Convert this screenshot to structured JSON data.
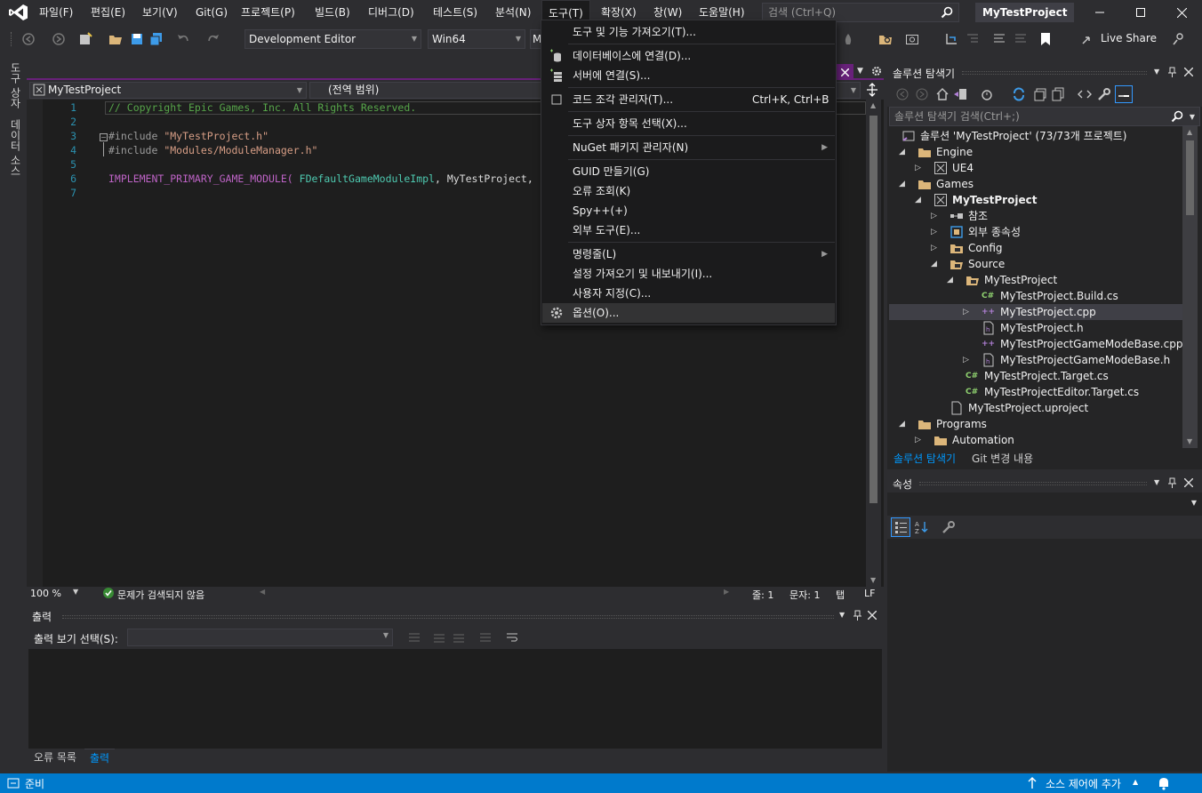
{
  "menu": {
    "file": "파일(F)",
    "edit": "편집(E)",
    "view": "보기(V)",
    "git": "Git(G)",
    "project": "프로젝트(P)",
    "build": "빌드(B)",
    "debug": "디버그(D)",
    "test": "테스트(S)",
    "analyze": "분석(N)",
    "tools": "도구(T)",
    "extensions": "확장(X)",
    "window": "창(W)",
    "help": "도움말(H)"
  },
  "search": {
    "placeholder": "검색 (Ctrl+Q)"
  },
  "window_title": "MyTestProject",
  "toolbar": {
    "config": "Development Editor",
    "platform": "Win64",
    "startup_partial": "M",
    "live_share": "Live Share"
  },
  "left_tabs": {
    "toolbox": "도구 상자",
    "data_sources": "데이터 소스"
  },
  "editor": {
    "project_combo": "MyTestProject",
    "scope_combo": "(전역 범위)",
    "lines": [
      {
        "num": "1",
        "comment": "// Copyright Epic Games, Inc. All Rights Reserved."
      },
      {
        "num": "2"
      },
      {
        "num": "3",
        "directive": "#include",
        "string": "\"MyTestProject.h\""
      },
      {
        "num": "4",
        "directive": "#include",
        "string": "\"Modules/ModuleManager.h\""
      },
      {
        "num": "5"
      },
      {
        "num": "6",
        "macro": "IMPLEMENT_PRIMARY_GAME_MODULE(",
        "type": "FDefaultGameModuleImpl",
        "rest": ", MyTestProject,"
      },
      {
        "num": "7"
      }
    ],
    "zoom": "100 %",
    "issues": "문제가 검색되지 않음",
    "line_label": "줄: 1",
    "char_label": "문자: 1",
    "tab_label": "탭",
    "eol_label": "LF"
  },
  "tools_menu": {
    "items": [
      {
        "label": "도구 및 기능 가져오기(T)..."
      },
      {
        "label": "데이터베이스에 연결(D)..."
      },
      {
        "label": "서버에 연결(S)..."
      },
      {
        "label": "코드 조각 관리자(T)...",
        "shortcut": "Ctrl+K, Ctrl+B"
      },
      {
        "label": "도구 상자 항목 선택(X)..."
      },
      {
        "label": "NuGet 패키지 관리자(N)"
      },
      {
        "label": "GUID 만들기(G)"
      },
      {
        "label": "오류 조회(K)"
      },
      {
        "label": "Spy++(+)"
      },
      {
        "label": "외부 도구(E)..."
      },
      {
        "label": "명령줄(L)"
      },
      {
        "label": "설정 가져오기 및 내보내기(I)..."
      },
      {
        "label": "사용자 지정(C)..."
      },
      {
        "label": "옵션(O)..."
      }
    ]
  },
  "output": {
    "title": "출력",
    "source_label": "출력 보기 선택(S):",
    "tabs": {
      "errors": "오류 목록",
      "output": "출력"
    }
  },
  "solution_explorer": {
    "title": "솔루션 탐색기",
    "search_placeholder": "솔루션 탐색기 검색(Ctrl+;)",
    "nodes": [
      {
        "label": "솔루션 'MyTestProject' (73/73개 프로젝트)"
      },
      {
        "label": "Engine"
      },
      {
        "label": "UE4"
      },
      {
        "label": "Games"
      },
      {
        "label": "MyTestProject"
      },
      {
        "label": "참조"
      },
      {
        "label": "외부 종속성"
      },
      {
        "label": "Config"
      },
      {
        "label": "Source"
      },
      {
        "label": "MyTestProject"
      },
      {
        "label": "MyTestProject.Build.cs"
      },
      {
        "label": "MyTestProject.cpp"
      },
      {
        "label": "MyTestProject.h"
      },
      {
        "label": "MyTestProjectGameModeBase.cpp"
      },
      {
        "label": "MyTestProjectGameModeBase.h"
      },
      {
        "label": "MyTestProject.Target.cs"
      },
      {
        "label": "MyTestProjectEditor.Target.cs"
      },
      {
        "label": "MyTestProject.uproject"
      },
      {
        "label": "Programs"
      },
      {
        "label": "Automation"
      }
    ],
    "tabs": {
      "solution": "솔루션 탐색기",
      "git": "Git 변경 내용"
    }
  },
  "properties": {
    "title": "속성"
  },
  "status": {
    "ready": "준비",
    "source_control": "소스 제어에 추가"
  },
  "colors": {
    "accent": "#007acc",
    "vs_purple": "#68217a",
    "background": "#2d2d30"
  }
}
